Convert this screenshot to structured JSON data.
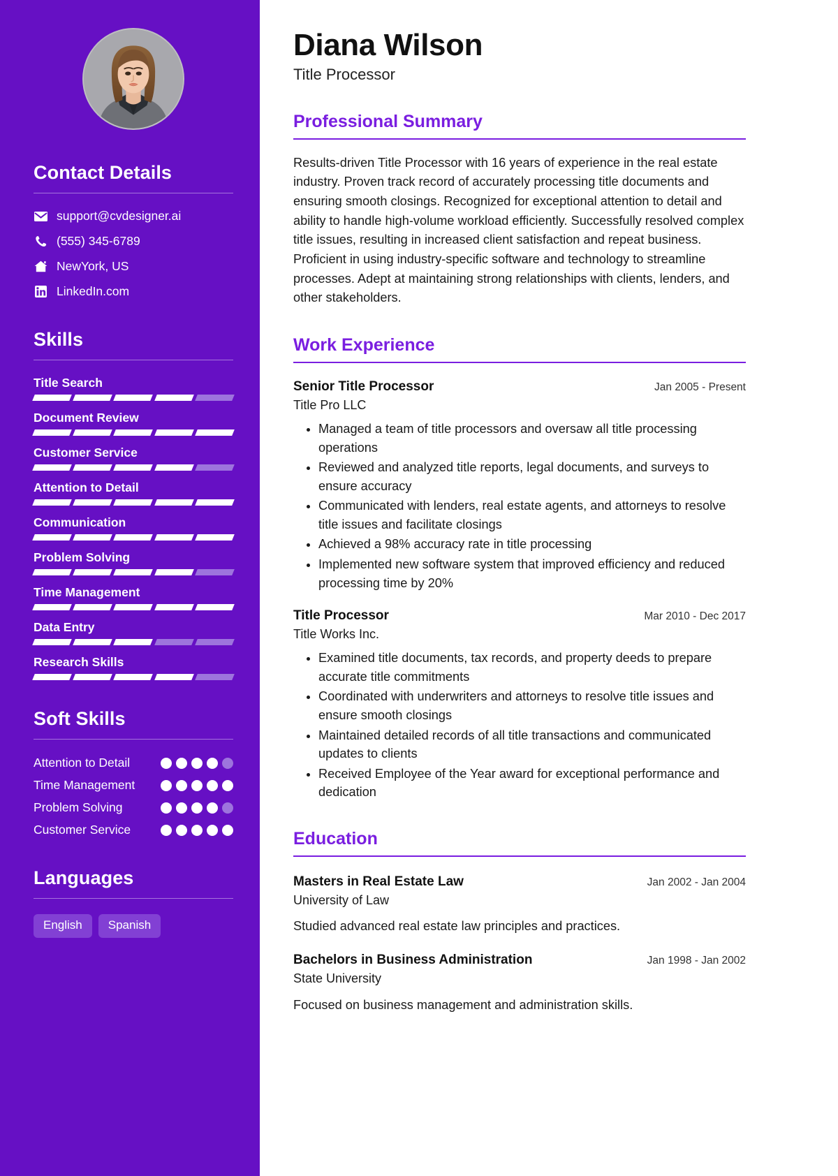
{
  "theme": {
    "sidebar_bg": "#6610c4",
    "accent": "#7a1ee0",
    "chip_bg": "#8240d4",
    "bar_off": "#9d74dd"
  },
  "header": {
    "name": "Diana Wilson",
    "title": "Title Processor"
  },
  "sidebar": {
    "contact_heading": "Contact Details",
    "contact": [
      {
        "icon": "envelope-icon",
        "value": "support@cvdesigner.ai"
      },
      {
        "icon": "phone-icon",
        "value": "(555) 345-6789"
      },
      {
        "icon": "home-icon",
        "value": "NewYork, US"
      },
      {
        "icon": "linkedin-icon",
        "value": "LinkedIn.com"
      }
    ],
    "skills_heading": "Skills",
    "skills": [
      {
        "name": "Title Search",
        "level": 4,
        "max": 5
      },
      {
        "name": "Document Review",
        "level": 5,
        "max": 5
      },
      {
        "name": "Customer Service",
        "level": 4,
        "max": 5
      },
      {
        "name": "Attention to Detail",
        "level": 5,
        "max": 5
      },
      {
        "name": "Communication",
        "level": 5,
        "max": 5
      },
      {
        "name": "Problem Solving",
        "level": 4,
        "max": 5
      },
      {
        "name": "Time Management",
        "level": 5,
        "max": 5
      },
      {
        "name": "Data Entry",
        "level": 3,
        "max": 5
      },
      {
        "name": "Research Skills",
        "level": 4,
        "max": 5
      }
    ],
    "soft_skills_heading": "Soft Skills",
    "soft_skills": [
      {
        "name": "Attention to Detail",
        "level": 4,
        "max": 5
      },
      {
        "name": "Time Management",
        "level": 5,
        "max": 5
      },
      {
        "name": "Problem Solving",
        "level": 4,
        "max": 5
      },
      {
        "name": "Customer Service",
        "level": 5,
        "max": 5
      }
    ],
    "languages_heading": "Languages",
    "languages": [
      "English",
      "Spanish"
    ]
  },
  "main": {
    "summary_heading": "Professional Summary",
    "summary_text": "Results-driven Title Processor with 16 years of experience in the real estate industry. Proven track record of accurately processing title documents and ensuring smooth closings. Recognized for exceptional attention to detail and ability to handle high-volume workload efficiently. Successfully resolved complex title issues, resulting in increased client satisfaction and repeat business. Proficient in using industry-specific software and technology to streamline processes. Adept at maintaining strong relationships with clients, lenders, and other stakeholders.",
    "experience_heading": "Work Experience",
    "experience": [
      {
        "title": "Senior Title Processor",
        "date": "Jan 2005 - Present",
        "org": "Title Pro LLC",
        "bullets": [
          "Managed a team of title processors and oversaw all title processing operations",
          "Reviewed and analyzed title reports, legal documents, and surveys to ensure accuracy",
          "Communicated with lenders, real estate agents, and attorneys to resolve title issues and facilitate closings",
          "Achieved a 98% accuracy rate in title processing",
          "Implemented new software system that improved efficiency and reduced processing time by 20%"
        ]
      },
      {
        "title": "Title Processor",
        "date": "Mar 2010 - Dec 2017",
        "org": "Title Works Inc.",
        "bullets": [
          "Examined title documents, tax records, and property deeds to prepare accurate title commitments",
          "Coordinated with underwriters and attorneys to resolve title issues and ensure smooth closings",
          "Maintained detailed records of all title transactions and communicated updates to clients",
          "Received Employee of the Year award for exceptional performance and dedication"
        ]
      }
    ],
    "education_heading": "Education",
    "education": [
      {
        "title": "Masters in Real Estate Law",
        "date": "Jan 2002 - Jan 2004",
        "org": "University of Law",
        "description": "Studied advanced real estate law principles and practices."
      },
      {
        "title": "Bachelors in Business Administration",
        "date": "Jan 1998 - Jan 2002",
        "org": "State University",
        "description": "Focused on business management and administration skills."
      }
    ]
  }
}
